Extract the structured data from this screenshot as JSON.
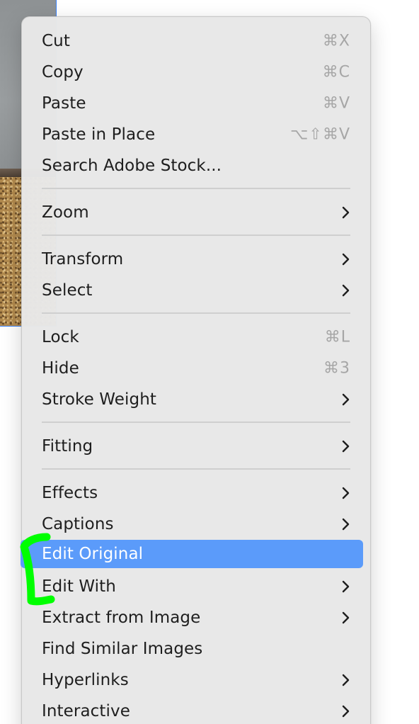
{
  "menu": {
    "items": [
      {
        "label": "Cut",
        "shortcut": "⌘X"
      },
      {
        "label": "Copy",
        "shortcut": "⌘C"
      },
      {
        "label": "Paste",
        "shortcut": "⌘V"
      },
      {
        "label": "Paste in Place",
        "shortcut": "⌥⇧⌘V"
      },
      {
        "label": "Search Adobe Stock..."
      },
      {
        "label": "Zoom",
        "submenu": true
      },
      {
        "label": "Transform",
        "submenu": true
      },
      {
        "label": "Select",
        "submenu": true
      },
      {
        "label": "Lock",
        "shortcut": "⌘L"
      },
      {
        "label": "Hide",
        "shortcut": "⌘3"
      },
      {
        "label": "Stroke Weight",
        "submenu": true
      },
      {
        "label": "Fitting",
        "submenu": true
      },
      {
        "label": "Effects",
        "submenu": true
      },
      {
        "label": "Captions",
        "submenu": true
      },
      {
        "label": "Edit Original",
        "highlighted": true
      },
      {
        "label": "Edit With",
        "submenu": true
      },
      {
        "label": "Extract from Image",
        "submenu": true
      },
      {
        "label": "Find Similar Images"
      },
      {
        "label": "Hyperlinks",
        "submenu": true
      },
      {
        "label": "Interactive",
        "submenu": true
      }
    ]
  },
  "colors": {
    "highlight": "#5b9bfa",
    "annotation": "#00ff00",
    "selection_frame": "#3b82f6"
  },
  "icons": {
    "submenu": "chevron-right-icon"
  }
}
